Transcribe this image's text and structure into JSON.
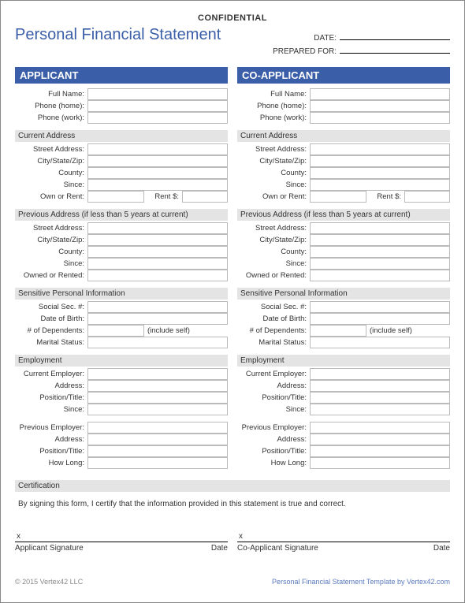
{
  "confidential": "CONFIDENTIAL",
  "title": "Personal Financial Statement",
  "date_label": "DATE:",
  "prepared_label": "PREPARED FOR:",
  "applicant": {
    "header": "APPLICANT",
    "full_name": "Full Name:",
    "phone_home": "Phone (home):",
    "phone_work": "Phone (work):",
    "current_address": "Current Address",
    "street": "Street Address:",
    "csz": "City/State/Zip:",
    "county": "County:",
    "since": "Since:",
    "own_rent": "Own or Rent:",
    "rent_amt": "Rent $:",
    "previous_address": "Previous Address (if less than 5 years at current)",
    "owned_rented": "Owned or Rented:",
    "spi": "Sensitive Personal Information",
    "ssn": "Social Sec. #:",
    "dob": "Date of Birth:",
    "dependents": "# of Dependents:",
    "include_self": "(include self)",
    "marital": "Marital Status:",
    "employment": "Employment",
    "cur_emp": "Current Employer:",
    "address": "Address:",
    "position": "Position/Title:",
    "emp_since": "Since:",
    "prev_emp": "Previous Employer:",
    "how_long": "How Long:"
  },
  "co": {
    "header": "CO-APPLICANT"
  },
  "certification": "Certification",
  "cert_text": "By signing this form, I certify that the information provided in this statement is true and correct.",
  "sig_x": "x",
  "sig_app": "Applicant Signature",
  "sig_coapp": "Co-Applicant Signature",
  "sig_date": "Date",
  "footer_left": "© 2015 Vertex42 LLC",
  "footer_right": "Personal Financial Statement Template by Vertex42.com"
}
